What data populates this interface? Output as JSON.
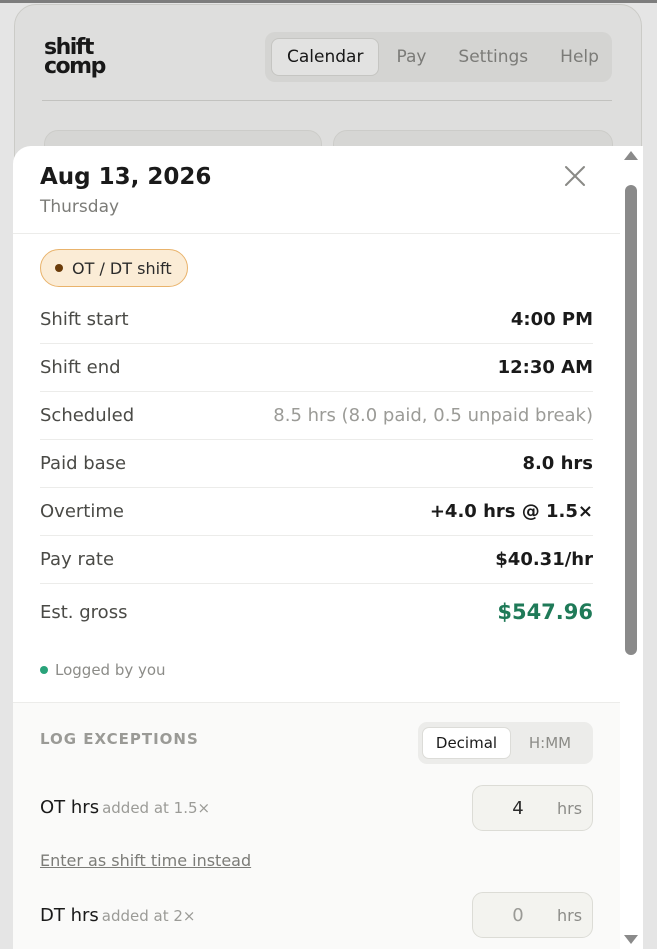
{
  "app": {
    "logo_line1": "shift",
    "logo_line2": "comp",
    "nav": [
      {
        "label": "Calendar",
        "active": true
      },
      {
        "label": "Pay",
        "active": false
      },
      {
        "label": "Settings",
        "active": false
      },
      {
        "label": "Help",
        "active": false
      }
    ]
  },
  "modal": {
    "date": "Aug 13, 2026",
    "weekday": "Thursday",
    "close_icon": "close-icon",
    "badge": "OT / DT shift",
    "rows": [
      {
        "label": "Shift start",
        "value": "4:00 PM"
      },
      {
        "label": "Shift end",
        "value": "12:30 AM"
      },
      {
        "label": "Scheduled",
        "value": "8.5 hrs (8.0 paid, 0.5 unpaid break)"
      },
      {
        "label": "Paid base",
        "value": "8.0 hrs"
      },
      {
        "label": "Overtime",
        "value": "+4.0 hrs @ 1.5×"
      },
      {
        "label": "Pay rate",
        "value": "$40.31/hr"
      },
      {
        "label": "Est. gross",
        "value": "$547.96"
      }
    ],
    "logged": "Logged by you"
  },
  "exceptions": {
    "title": "LOG EXCEPTIONS",
    "format_options": [
      "Decimal",
      "H:MM"
    ],
    "selected_format": "Decimal",
    "ot": {
      "label": "OT hrs",
      "note": "added at 1.5×",
      "value": "4",
      "unit": "hrs"
    },
    "link": "Enter as shift time instead",
    "dt": {
      "label": "DT hrs",
      "note": "added at 2×",
      "value": "0",
      "unit": "hrs"
    }
  },
  "colors": {
    "badge_bg": "#fbecd6",
    "badge_border": "#e9b36c",
    "money": "#1f7a58",
    "logged_dot": "#29a37a"
  }
}
